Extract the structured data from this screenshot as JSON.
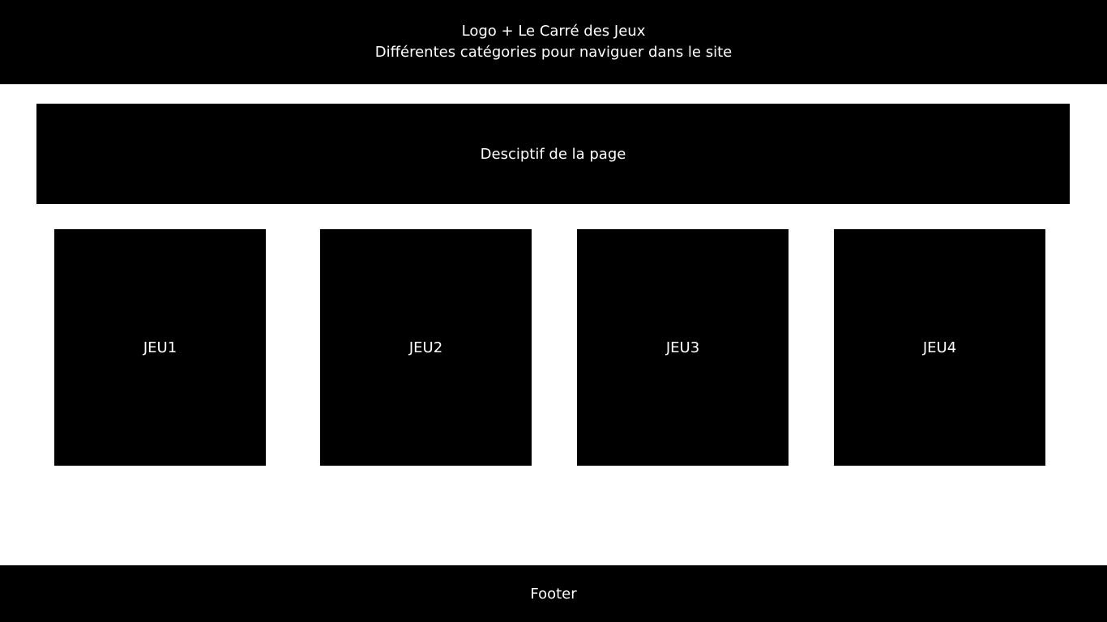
{
  "header": {
    "title": "Logo + Le Carré des Jeux",
    "nav_description": "Différentes catégories pour naviguer dans le site"
  },
  "hero": {
    "description": "Desciptif de la page"
  },
  "games": [
    {
      "label": "JEU1"
    },
    {
      "label": "JEU2"
    },
    {
      "label": "JEU3"
    },
    {
      "label": "JEU4"
    }
  ],
  "footer": {
    "label": "Footer"
  },
  "colors": {
    "block_background": "#000000",
    "page_background": "#ffffff",
    "text": "#ffffff"
  }
}
